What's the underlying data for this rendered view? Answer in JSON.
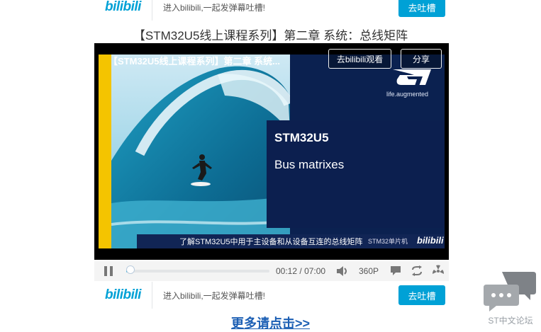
{
  "top_bar": {
    "logo": "bilibili",
    "prompt": "进入bilibili,一起发弹幕吐槽!",
    "button": "去吐槽"
  },
  "page_title": "【STM32U5线上课程系列】第二章 系统：总线矩阵",
  "player": {
    "video_title": "【STM32U5线上课程系列】第二章 系统...",
    "watch_button": "去bilibili观看",
    "share_button": "分享",
    "slide": {
      "heading": "STM32U5",
      "subheading": "Bus matrixes",
      "tagline": "life.augmented",
      "caption": "了解STM32U5中用于主设备和从设备互连的总线矩阵",
      "caption_brand": "STM32单片机",
      "caption_brand2": "bilibili"
    }
  },
  "controls": {
    "current_time": "00:12",
    "separator": "/",
    "duration": "07:00",
    "progress_fraction": 0.03,
    "quality": "360P",
    "icons": [
      "pause-icon",
      "volume-icon",
      "danmaku-icon",
      "loop-icon",
      "radiation-icon"
    ]
  },
  "bottom_bar": {
    "logo": "bilibili",
    "prompt": "进入bilibili,一起发弹幕吐槽!",
    "button": "去吐槽"
  },
  "more_link": "更多请点击>>",
  "forum": {
    "label": "ST中文论坛"
  },
  "colors": {
    "accent": "#00a1d6",
    "link": "#1c5fb4",
    "slide_bg": "#0b2150",
    "stripe": "#f4c400"
  }
}
